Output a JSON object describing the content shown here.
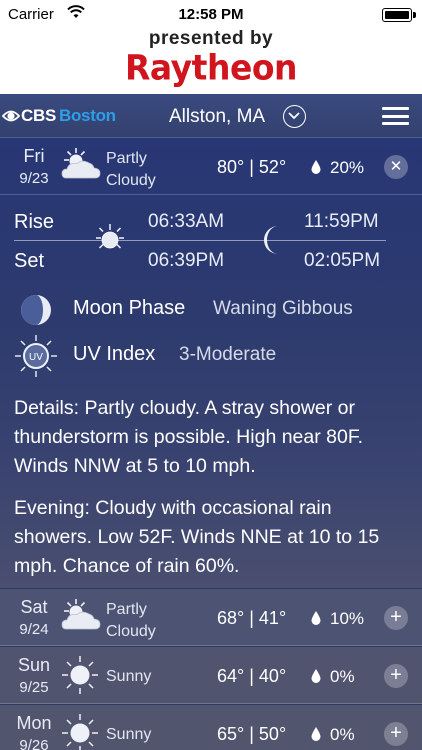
{
  "status_bar": {
    "carrier": "Carrier",
    "time": "12:58 PM"
  },
  "sponsor": {
    "presented_by": "presented by",
    "brand": "Raytheon"
  },
  "header": {
    "logo_cbs": "CBS",
    "logo_boston": "Boston",
    "location": "Allston, MA"
  },
  "today": {
    "day": "Fri",
    "date": "9/23",
    "condition": "Partly Cloudy",
    "high": "80°",
    "low": "52°",
    "precip": "20%",
    "toggle_icon": "close-icon"
  },
  "sun_moon": {
    "rise_label": "Rise",
    "set_label": "Set",
    "sun_rise": "06:33AM",
    "sun_set": "06:39PM",
    "moon_rise": "11:59PM",
    "moon_set": "02:05PM"
  },
  "moon_phase": {
    "label": "Moon Phase",
    "value": "Waning Gibbous"
  },
  "uv_index": {
    "label": "UV Index",
    "value": "3-Moderate",
    "icon_text": "UV"
  },
  "details": {
    "day_text": "Details: Partly cloudy. A stray shower or thunderstorm is possible. High near 80F. Winds NNW at 5 to 10 mph.",
    "evening_text": "Evening: Cloudy with occasional rain showers. Low 52F. Winds NNE at 10 to 15 mph. Chance of rain 60%."
  },
  "forecast": [
    {
      "day": "Sat",
      "date": "9/24",
      "condition": "Partly Cloudy",
      "high": "68°",
      "low": "41°",
      "precip": "10%",
      "icon": "partly-cloudy-icon"
    },
    {
      "day": "Sun",
      "date": "9/25",
      "condition": "Sunny",
      "high": "64°",
      "low": "40°",
      "precip": "0%",
      "icon": "sunny-icon"
    },
    {
      "day": "Mon",
      "date": "9/26",
      "condition": "Sunny",
      "high": "65°",
      "low": "50°",
      "precip": "0%",
      "icon": "sunny-icon"
    }
  ],
  "colors": {
    "brand_red": "#d0151e",
    "cbs_blue": "#2d9ee8",
    "panel_bg": "#2c3a6e"
  }
}
